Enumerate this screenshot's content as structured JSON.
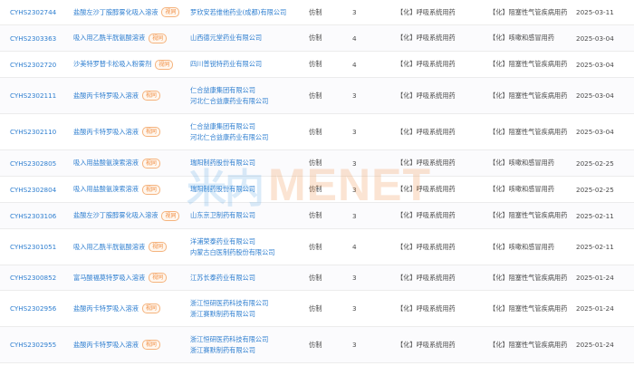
{
  "rows": [
    {
      "code": "CYHS2302744",
      "name": "盐酸左沙丁胺醇雾化吸入溶液",
      "tag": "视同",
      "companies": [
        "罗欣安若维他药业(成都)有限公司"
      ],
      "type": "仿制",
      "num": "3",
      "cls": "【化】呼吸系统用药",
      "ind": "【化】阻塞性气管疾病用药",
      "date": "2025-03-11"
    },
    {
      "code": "CYHS2303363",
      "name": "吸入用乙酰半胱氨酸溶液",
      "tag": "视同",
      "companies": [
        "山西德元堂药业有限公司"
      ],
      "type": "仿制",
      "num": "4",
      "cls": "【化】呼吸系统用药",
      "ind": "【化】咳嗽和感冒用药",
      "date": "2025-03-04"
    },
    {
      "code": "CYHS2302720",
      "name": "沙美特罗替卡松吸入粉雾剂",
      "tag": "视同",
      "companies": [
        "四川普锐特药业有限公司"
      ],
      "type": "仿制",
      "num": "4",
      "cls": "【化】呼吸系统用药",
      "ind": "【化】阻塞性气管疾病用药",
      "date": "2025-03-04"
    },
    {
      "code": "CYHS2302111",
      "name": "盐酸丙卡特罗吸入溶液",
      "tag": "视同",
      "companies": [
        "仁合益康集团有限公司",
        "河北仁合益康药业有限公司"
      ],
      "type": "仿制",
      "num": "3",
      "cls": "【化】呼吸系统用药",
      "ind": "【化】阻塞性气管疾病用药",
      "date": "2025-03-04"
    },
    {
      "code": "CYHS2302110",
      "name": "盐酸丙卡特罗吸入溶液",
      "tag": "视同",
      "companies": [
        "仁合益康集团有限公司",
        "河北仁合益康药业有限公司"
      ],
      "type": "仿制",
      "num": "3",
      "cls": "【化】呼吸系统用药",
      "ind": "【化】阻塞性气管疾病用药",
      "date": "2025-03-04"
    },
    {
      "code": "CYHS2302805",
      "name": "吸入用盐酸氨溴索溶液",
      "tag": "视同",
      "companies": [
        "瑞阳制药股份有限公司"
      ],
      "type": "仿制",
      "num": "3",
      "cls": "【化】呼吸系统用药",
      "ind": "【化】咳嗽和感冒用药",
      "date": "2025-02-25"
    },
    {
      "code": "CYHS2302804",
      "name": "吸入用盐酸氨溴索溶液",
      "tag": "视同",
      "companies": [
        "瑞阳制药股份有限公司"
      ],
      "type": "仿制",
      "num": "3",
      "cls": "【化】呼吸系统用药",
      "ind": "【化】咳嗽和感冒用药",
      "date": "2025-02-25"
    },
    {
      "code": "CYHS2303106",
      "name": "盐酸左沙丁胺醇雾化吸入溶液",
      "tag": "视同",
      "companies": [
        "山东京卫制药有限公司"
      ],
      "type": "仿制",
      "num": "3",
      "cls": "【化】呼吸系统用药",
      "ind": "【化】阻塞性气管疾病用药",
      "date": "2025-02-11"
    },
    {
      "code": "CYHS2301051",
      "name": "吸入用乙酰半胱氨酸溶液",
      "tag": "视同",
      "companies": [
        "洋浦荣泰药业有限公司",
        "内蒙古白医制药股份有限公司"
      ],
      "type": "仿制",
      "num": "4",
      "cls": "【化】呼吸系统用药",
      "ind": "【化】咳嗽和感冒用药",
      "date": "2025-02-11"
    },
    {
      "code": "CYHS2300852",
      "name": "富马酸福莫特罗吸入溶液",
      "tag": "视同",
      "companies": [
        "江苏长泰药业有限公司"
      ],
      "type": "仿制",
      "num": "3",
      "cls": "【化】呼吸系统用药",
      "ind": "【化】阻塞性气管疾病用药",
      "date": "2025-01-24"
    },
    {
      "code": "CYHS2302956",
      "name": "盐酸丙卡特罗吸入溶液",
      "tag": "视同",
      "companies": [
        "浙江恒研医药科技有限公司",
        "浙江赛默制药有限公司"
      ],
      "type": "仿制",
      "num": "3",
      "cls": "【化】呼吸系统用药",
      "ind": "【化】阻塞性气管疾病用药",
      "date": "2025-01-24"
    },
    {
      "code": "CYHS2302955",
      "name": "盐酸丙卡特罗吸入溶液",
      "tag": "视同",
      "companies": [
        "浙江恒研医药科技有限公司",
        "浙江赛默制药有限公司"
      ],
      "type": "仿制",
      "num": "3",
      "cls": "【化】呼吸系统用药",
      "ind": "【化】阻塞性气管疾病用药",
      "date": "2025-01-24"
    }
  ],
  "watermark": {
    "cn": "米内",
    "en": "MENET"
  },
  "colors": {
    "link": "#2f7fd0",
    "tag": "#f08a3c",
    "text": "#4a4a4a",
    "border": "#ececec"
  }
}
